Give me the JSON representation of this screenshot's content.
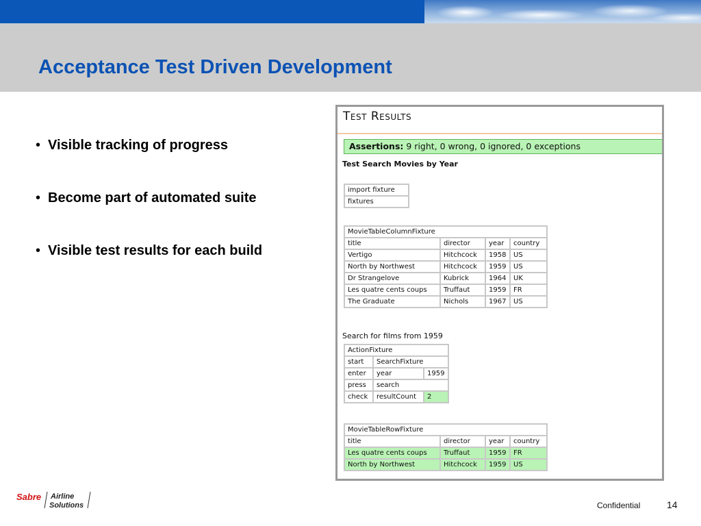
{
  "slide": {
    "title": "Acceptance Test Driven Development",
    "bullets": [
      "Visible tracking of progress",
      "Become part of automated suite",
      "Visible test results for each build"
    ],
    "footer": {
      "logo_brand": "Sabre",
      "logo_line1": "Airline",
      "logo_line2": "Solutions",
      "confidential": "Confidential",
      "page_number": "14"
    }
  },
  "test_results": {
    "title": "Test Results",
    "assertions_label": "Assertions:",
    "assertions_text": "9 right, 0 wrong, 0 ignored, 0 exceptions",
    "suite_name": "Test Search Movies by Year",
    "import_table": [
      [
        "import fixture"
      ],
      [
        "fixtures"
      ]
    ],
    "column_fixture": {
      "name": "MovieTableColumnFixture",
      "headers": [
        "title",
        "director",
        "year",
        "country"
      ],
      "rows": [
        [
          "Vertigo",
          "Hitchcock",
          "1958",
          "US"
        ],
        [
          "North by Northwest",
          "Hitchcock",
          "1959",
          "US"
        ],
        [
          "Dr Strangelove",
          "Kubrick",
          "1964",
          "UK"
        ],
        [
          "Les quatre cents coups",
          "Truffaut",
          "1959",
          "FR"
        ],
        [
          "The Graduate",
          "Nichols",
          "1967",
          "US"
        ]
      ]
    },
    "search_label": "Search for films from 1959",
    "action_fixture": {
      "name": "ActionFixture",
      "rows": [
        [
          "start",
          "SearchFixture",
          ""
        ],
        [
          "enter",
          "year",
          "1959"
        ],
        [
          "press",
          "search",
          ""
        ],
        [
          "check",
          "resultCount",
          "2"
        ]
      ]
    },
    "row_fixture": {
      "name": "MovieTableRowFixture",
      "headers": [
        "title",
        "director",
        "year",
        "country"
      ],
      "rows": [
        [
          "Les quatre cents coups",
          "Truffaut",
          "1959",
          "FR"
        ],
        [
          "North by Northwest",
          "Hitchcock",
          "1959",
          "US"
        ]
      ]
    }
  },
  "colors": {
    "brand_blue": "#0b57b8",
    "title_blue": "#0b52b4",
    "pass_green": "#b9f3b5"
  }
}
